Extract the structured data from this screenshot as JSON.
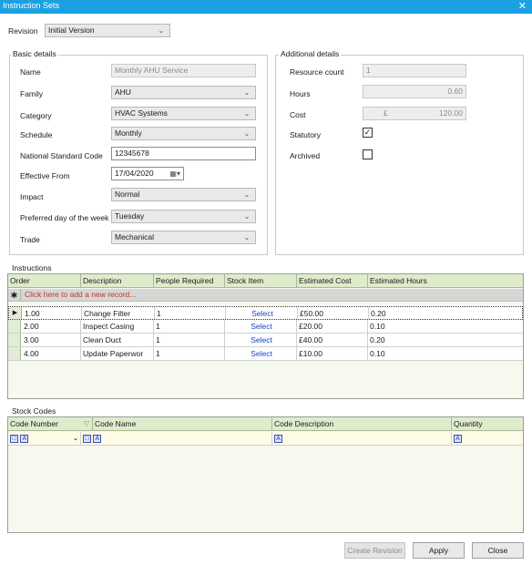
{
  "window": {
    "title": "Instruction Sets",
    "close_glyph": "✕"
  },
  "revision": {
    "label": "Revision",
    "value": "Initial Version"
  },
  "basic": {
    "group_label": "Basic details",
    "name_label": "Name",
    "name_value": "Monthly AHU Service",
    "family_label": "Family",
    "family_value": "AHU",
    "category_label": "Category",
    "category_value": "HVAC Systems",
    "schedule_label": "Schedule",
    "schedule_value": "Monthly",
    "nsc_label": "National Standard Code",
    "nsc_value": "12345678",
    "effective_label": "Effective From",
    "effective_value": "17/04/2020",
    "impact_label": "Impact",
    "impact_value": "Normal",
    "preferred_label": "Preferred day of the week",
    "preferred_value": "Tuesday",
    "trade_label": "Trade",
    "trade_value": "Mechanical"
  },
  "additional": {
    "group_label": "Additional details",
    "resource_label": "Resource count",
    "resource_value": "1",
    "hours_label": "Hours",
    "hours_value": "0.60",
    "cost_label": "Cost",
    "cost_currency": "£",
    "cost_value": "120.00",
    "statutory_label": "Statutory",
    "statutory_checked": true,
    "archived_label": "Archived",
    "archived_checked": false
  },
  "instructions": {
    "group_label": "Instructions",
    "columns": [
      "Order",
      "Description",
      "People Required",
      "Stock Item",
      "Estimated Cost",
      "Estimated Hours"
    ],
    "add_row_text": "Click here to add a new record...",
    "rows": [
      {
        "order": "1.00",
        "description": "Change Filter",
        "people": "1",
        "stock": "Select",
        "cost": "£50.00",
        "hours": "0.20"
      },
      {
        "order": "2.00",
        "description": "Inspect Casing",
        "people": "1",
        "stock": "Select",
        "cost": "£20.00",
        "hours": "0.10"
      },
      {
        "order": "3.00",
        "description": "Clean Duct",
        "people": "1",
        "stock": "Select",
        "cost": "£40.00",
        "hours": "0.20"
      },
      {
        "order": "4.00",
        "description": "Update Paperwor",
        "people": "1",
        "stock": "Select",
        "cost": "£10.00",
        "hours": "0.10"
      }
    ]
  },
  "stock": {
    "group_label": "Stock Codes",
    "columns": [
      "Code Number",
      "Code Name",
      "Code Description",
      "Quantity"
    ]
  },
  "buttons": {
    "create_revision": "Create Revision",
    "apply": "Apply",
    "close": "Close"
  },
  "colors": {
    "titlebar": "#1ba1e2",
    "grid_header": "#dfeccb",
    "link": "#1a3fc7",
    "add_row_text": "#c0392b"
  }
}
